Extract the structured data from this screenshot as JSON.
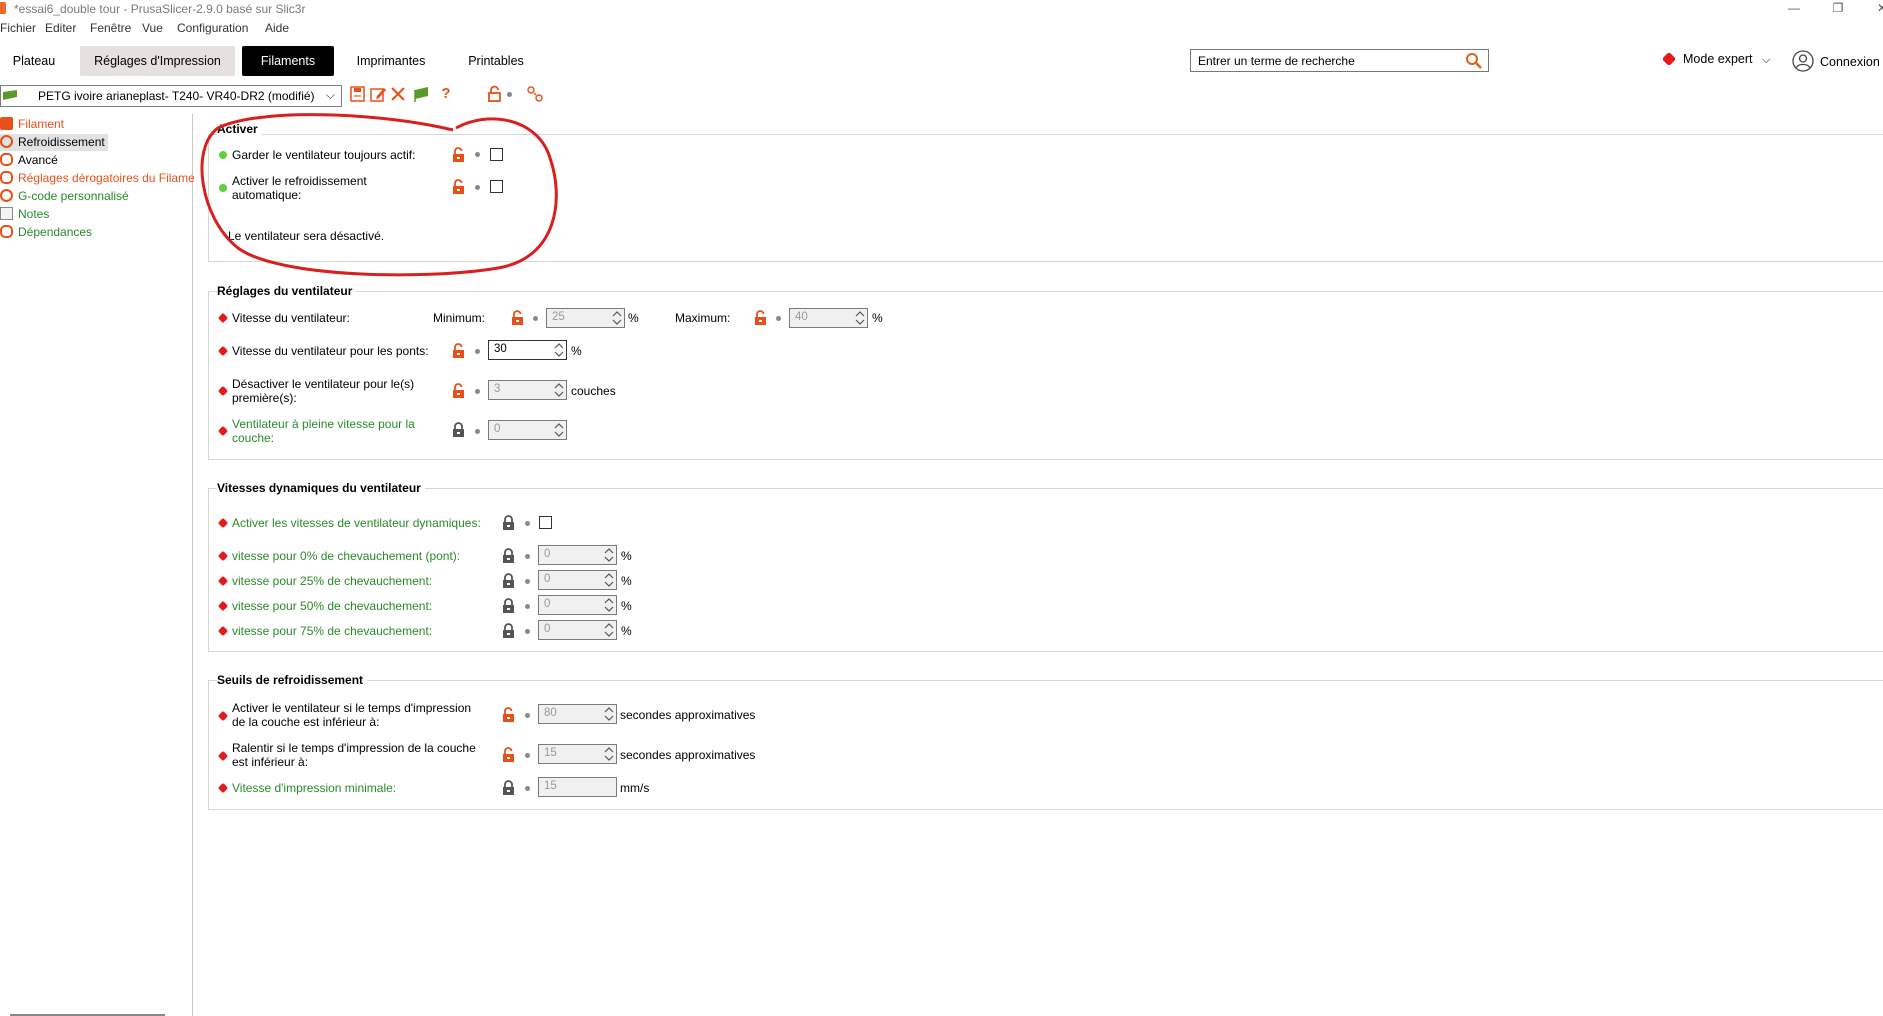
{
  "window": {
    "title": "*essai6_double tour - PrusaSlicer-2.9.0 basé sur Slic3r",
    "controls": [
      "—",
      "❐",
      "✕"
    ]
  },
  "menu": [
    "Fichier",
    "Editer",
    "Fenêtre",
    "Vue",
    "Configuration",
    "Aide"
  ],
  "tabs": [
    {
      "label": "Plateau"
    },
    {
      "label": "Réglages d'Impression"
    },
    {
      "label": "Filaments"
    },
    {
      "label": "Imprimantes"
    },
    {
      "label": "Printables"
    }
  ],
  "search": {
    "placeholder": "Entrer un terme de recherche"
  },
  "mode": {
    "label": "Mode expert",
    "color": "#e31a1a"
  },
  "account": {
    "label": "Connexion"
  },
  "preset": {
    "name": "PETG ivoire arianeplast- T240- VR40-DR2 (modifié)"
  },
  "toolbar_icons": [
    "save-icon",
    "edit-icon",
    "delete-icon",
    "flag-icon",
    "help-icon",
    "unlock-icon",
    "bullet-icon",
    "compare-icon"
  ],
  "tree": [
    {
      "label": "Filament",
      "color": "orange",
      "icon": "spool-icon"
    },
    {
      "label": "Refroidissement",
      "color": "black",
      "icon": "fan-icon",
      "selected": true
    },
    {
      "label": "Avancé",
      "color": "black",
      "icon": "wrench-icon"
    },
    {
      "label": "Réglages dérogatoires du Filame",
      "color": "orange",
      "icon": "wrench-icon"
    },
    {
      "label": "G-code personnalisé",
      "color": "green",
      "icon": "gear-icon"
    },
    {
      "label": "Notes",
      "color": "green",
      "icon": "notes-icon"
    },
    {
      "label": "Dépendances",
      "color": "green",
      "icon": "wrench-icon"
    }
  ],
  "groups": {
    "activer": {
      "title": "Activer",
      "opt1": "Garder le ventilateur toujours actif:",
      "opt2": "Activer le refroidissement automatique:",
      "info": "Le ventilateur sera désactivé."
    },
    "reglages": {
      "title": "Réglages du ventilateur",
      "vitesse": "Vitesse du ventilateur:",
      "minimum": "Minimum:",
      "min_val": "25",
      "maximum": "Maximum:",
      "max_val": "40",
      "ponts": "Vitesse du ventilateur pour les ponts:",
      "ponts_val": "30",
      "desactiver": "Désactiver le ventilateur pour le(s) première(s):",
      "desactiver_val": "3",
      "couches": "couches",
      "pleine": "Ventilateur à pleine vitesse pour la couche:",
      "pleine_val": "0",
      "pct": "%"
    },
    "dynamiques": {
      "title": "Vitesses dynamiques du ventilateur",
      "activer": "Activer les vitesses de ventilateur dynamiques:",
      "v0": "vitesse pour 0% de chevauchement (pont):",
      "v25": "vitesse pour 25% de chevauchement:",
      "v50": "vitesse pour 50% de chevauchement:",
      "v75": "vitesse pour 75% de chevauchement:",
      "val": "0",
      "pct": "%"
    },
    "seuils": {
      "title": "Seuils de refroidissement",
      "activer": "Activer le ventilateur si le temps d'impression de la couche est inférieur à:",
      "activer_val": "80",
      "ralentir": "Ralentir si le temps d'impression de la couche est inférieur à:",
      "ralentir_val": "15",
      "secondes": "secondes approximatives",
      "vitesse_min": "Vitesse d'impression minimale:",
      "vitesse_min_val": "15",
      "mms": "mm/s"
    }
  },
  "colors": {
    "orange": "#e8501a",
    "green": "#2a8a2a",
    "red": "#e31a1a",
    "annotation": "#d91f1f"
  }
}
